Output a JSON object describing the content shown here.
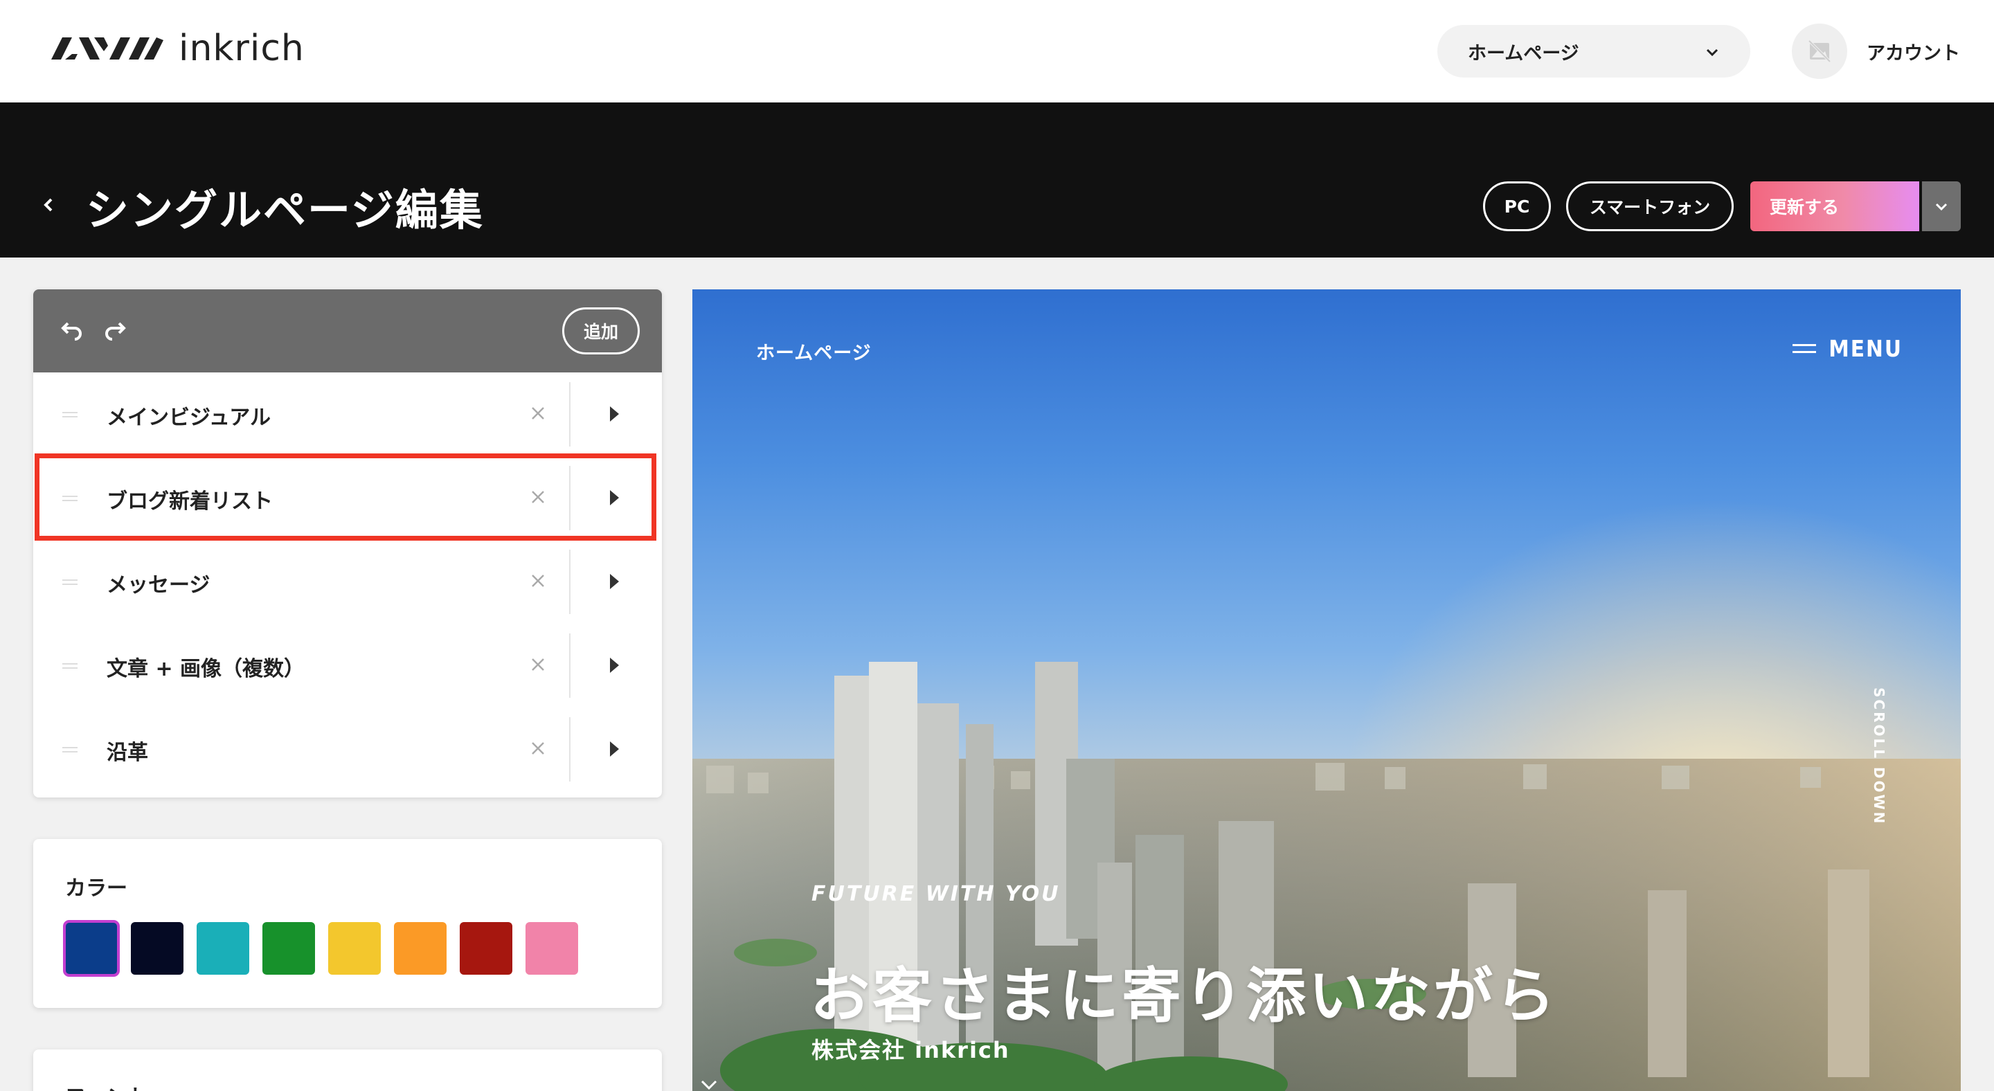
{
  "header": {
    "logo_text": "inkrich",
    "page_select": "ホームページ",
    "account_label": "アカウント"
  },
  "titlebar": {
    "title": "シングルページ編集",
    "pc_label": "PC",
    "smartphone_label": "スマートフォン",
    "update_label": "更新する"
  },
  "sections": {
    "add_label": "追加",
    "items": [
      {
        "label": "メインビジュアル"
      },
      {
        "label": "ブログ新着リスト"
      },
      {
        "label": "メッセージ"
      },
      {
        "label": "文章 + 画像（複数）"
      },
      {
        "label": "沿革"
      }
    ],
    "highlighted_index": 1
  },
  "color": {
    "title": "カラー",
    "swatches": [
      "#0b3d8a",
      "#050a24",
      "#1aafb8",
      "#17912b",
      "#f3c72d",
      "#fb9a26",
      "#a6170f",
      "#f183a9"
    ],
    "selected_index": 0
  },
  "font": {
    "title": "フォント"
  },
  "preview": {
    "nav_home": "ホームページ",
    "menu_label": "MENU",
    "scroll_label": "SCROLL DOWN",
    "tagline": "FUTURE WITH YOU",
    "headline": "お客さまに寄り添いながら",
    "company": "株式会社 inkrich"
  },
  "icons": {
    "back": "chevron-left-icon",
    "dropdown": "chevron-down-icon",
    "undo": "undo-icon",
    "redo": "redo-icon",
    "drag": "drag-handle-icon",
    "remove": "close-icon",
    "open": "caret-right-icon",
    "menu": "hamburger-icon"
  }
}
